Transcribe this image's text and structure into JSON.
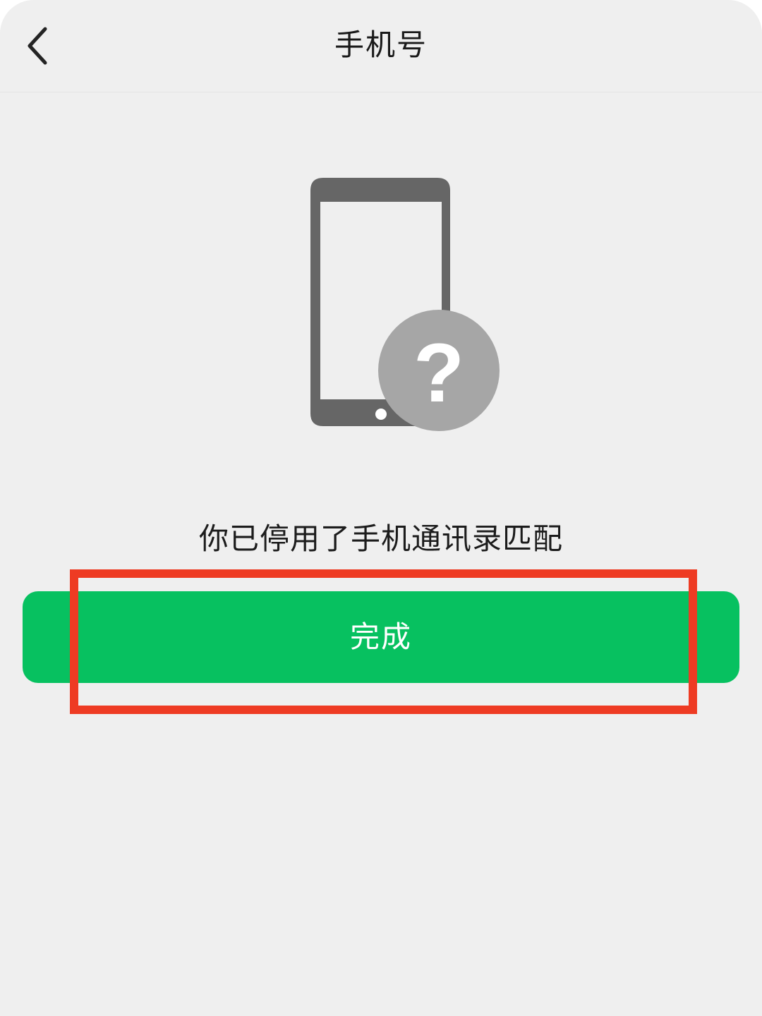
{
  "header": {
    "title": "手机号",
    "back_icon": "chevron-left-icon"
  },
  "illustration": {
    "phone_icon": "smartphone-icon",
    "badge_icon": "question-mark-icon",
    "badge_text": "?"
  },
  "main": {
    "message": "你已停用了手机通讯录匹配",
    "done_label": "完成"
  },
  "colors": {
    "background": "#efefef",
    "accent_green": "#07c160",
    "phone_gray": "#666666",
    "badge_gray": "#a6a6a6",
    "highlight_red": "#ee3b23"
  }
}
